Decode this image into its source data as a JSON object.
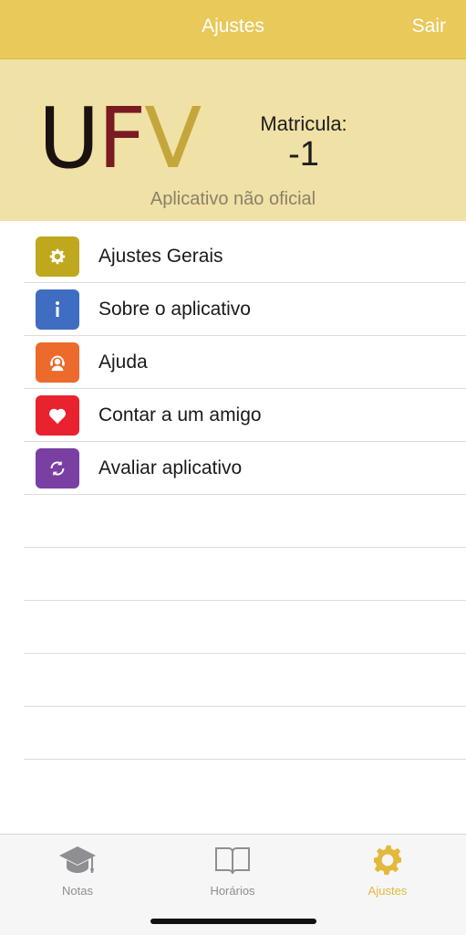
{
  "navbar": {
    "title": "Ajustes",
    "action": "Sair"
  },
  "header": {
    "logo": {
      "u": "U",
      "f": "F",
      "v": "V"
    },
    "matricula_label": "Matricula:",
    "matricula_value": "-1",
    "subtitle": "Aplicativo não oficial"
  },
  "menu": [
    {
      "label": "Ajustes Gerais",
      "icon": "gear-icon",
      "color": "#bfa81e"
    },
    {
      "label": "Sobre o aplicativo",
      "icon": "info-icon",
      "color": "#3f6dc2"
    },
    {
      "label": "Ajuda",
      "icon": "support-agent-icon",
      "color": "#ec6a2c"
    },
    {
      "label": "Contar a um amigo",
      "icon": "heart-icon",
      "color": "#e8232f"
    },
    {
      "label": "Avaliar aplicativo",
      "icon": "refresh-icon",
      "color": "#7a3fa3"
    }
  ],
  "tabs": [
    {
      "label": "Notas",
      "icon": "graduation-cap-icon",
      "active": false
    },
    {
      "label": "Horários",
      "icon": "book-icon",
      "active": false
    },
    {
      "label": "Ajustes",
      "icon": "gear-icon",
      "active": true
    }
  ],
  "colors": {
    "accent": "#e8c95a",
    "header_bg": "#f0e1a6",
    "active_tab": "#e2b93b"
  }
}
